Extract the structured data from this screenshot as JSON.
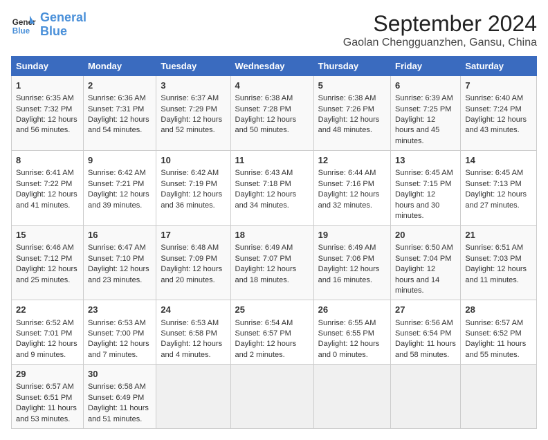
{
  "logo": {
    "line1": "General",
    "line2": "Blue"
  },
  "title": "September 2024",
  "subtitle": "Gaolan Chengguanzhen, Gansu, China",
  "days_of_week": [
    "Sunday",
    "Monday",
    "Tuesday",
    "Wednesday",
    "Thursday",
    "Friday",
    "Saturday"
  ],
  "weeks": [
    [
      {
        "day": "1",
        "sunrise": "6:35 AM",
        "sunset": "7:32 PM",
        "daylight": "12 hours and 56 minutes."
      },
      {
        "day": "2",
        "sunrise": "6:36 AM",
        "sunset": "7:31 PM",
        "daylight": "12 hours and 54 minutes."
      },
      {
        "day": "3",
        "sunrise": "6:37 AM",
        "sunset": "7:29 PM",
        "daylight": "12 hours and 52 minutes."
      },
      {
        "day": "4",
        "sunrise": "6:38 AM",
        "sunset": "7:28 PM",
        "daylight": "12 hours and 50 minutes."
      },
      {
        "day": "5",
        "sunrise": "6:38 AM",
        "sunset": "7:26 PM",
        "daylight": "12 hours and 48 minutes."
      },
      {
        "day": "6",
        "sunrise": "6:39 AM",
        "sunset": "7:25 PM",
        "daylight": "12 hours and 45 minutes."
      },
      {
        "day": "7",
        "sunrise": "6:40 AM",
        "sunset": "7:24 PM",
        "daylight": "12 hours and 43 minutes."
      }
    ],
    [
      {
        "day": "8",
        "sunrise": "6:41 AM",
        "sunset": "7:22 PM",
        "daylight": "12 hours and 41 minutes."
      },
      {
        "day": "9",
        "sunrise": "6:42 AM",
        "sunset": "7:21 PM",
        "daylight": "12 hours and 39 minutes."
      },
      {
        "day": "10",
        "sunrise": "6:42 AM",
        "sunset": "7:19 PM",
        "daylight": "12 hours and 36 minutes."
      },
      {
        "day": "11",
        "sunrise": "6:43 AM",
        "sunset": "7:18 PM",
        "daylight": "12 hours and 34 minutes."
      },
      {
        "day": "12",
        "sunrise": "6:44 AM",
        "sunset": "7:16 PM",
        "daylight": "12 hours and 32 minutes."
      },
      {
        "day": "13",
        "sunrise": "6:45 AM",
        "sunset": "7:15 PM",
        "daylight": "12 hours and 30 minutes."
      },
      {
        "day": "14",
        "sunrise": "6:45 AM",
        "sunset": "7:13 PM",
        "daylight": "12 hours and 27 minutes."
      }
    ],
    [
      {
        "day": "15",
        "sunrise": "6:46 AM",
        "sunset": "7:12 PM",
        "daylight": "12 hours and 25 minutes."
      },
      {
        "day": "16",
        "sunrise": "6:47 AM",
        "sunset": "7:10 PM",
        "daylight": "12 hours and 23 minutes."
      },
      {
        "day": "17",
        "sunrise": "6:48 AM",
        "sunset": "7:09 PM",
        "daylight": "12 hours and 20 minutes."
      },
      {
        "day": "18",
        "sunrise": "6:49 AM",
        "sunset": "7:07 PM",
        "daylight": "12 hours and 18 minutes."
      },
      {
        "day": "19",
        "sunrise": "6:49 AM",
        "sunset": "7:06 PM",
        "daylight": "12 hours and 16 minutes."
      },
      {
        "day": "20",
        "sunrise": "6:50 AM",
        "sunset": "7:04 PM",
        "daylight": "12 hours and 14 minutes."
      },
      {
        "day": "21",
        "sunrise": "6:51 AM",
        "sunset": "7:03 PM",
        "daylight": "12 hours and 11 minutes."
      }
    ],
    [
      {
        "day": "22",
        "sunrise": "6:52 AM",
        "sunset": "7:01 PM",
        "daylight": "12 hours and 9 minutes."
      },
      {
        "day": "23",
        "sunrise": "6:53 AM",
        "sunset": "7:00 PM",
        "daylight": "12 hours and 7 minutes."
      },
      {
        "day": "24",
        "sunrise": "6:53 AM",
        "sunset": "6:58 PM",
        "daylight": "12 hours and 4 minutes."
      },
      {
        "day": "25",
        "sunrise": "6:54 AM",
        "sunset": "6:57 PM",
        "daylight": "12 hours and 2 minutes."
      },
      {
        "day": "26",
        "sunrise": "6:55 AM",
        "sunset": "6:55 PM",
        "daylight": "12 hours and 0 minutes."
      },
      {
        "day": "27",
        "sunrise": "6:56 AM",
        "sunset": "6:54 PM",
        "daylight": "11 hours and 58 minutes."
      },
      {
        "day": "28",
        "sunrise": "6:57 AM",
        "sunset": "6:52 PM",
        "daylight": "11 hours and 55 minutes."
      }
    ],
    [
      {
        "day": "29",
        "sunrise": "6:57 AM",
        "sunset": "6:51 PM",
        "daylight": "11 hours and 53 minutes."
      },
      {
        "day": "30",
        "sunrise": "6:58 AM",
        "sunset": "6:49 PM",
        "daylight": "11 hours and 51 minutes."
      },
      null,
      null,
      null,
      null,
      null
    ]
  ]
}
